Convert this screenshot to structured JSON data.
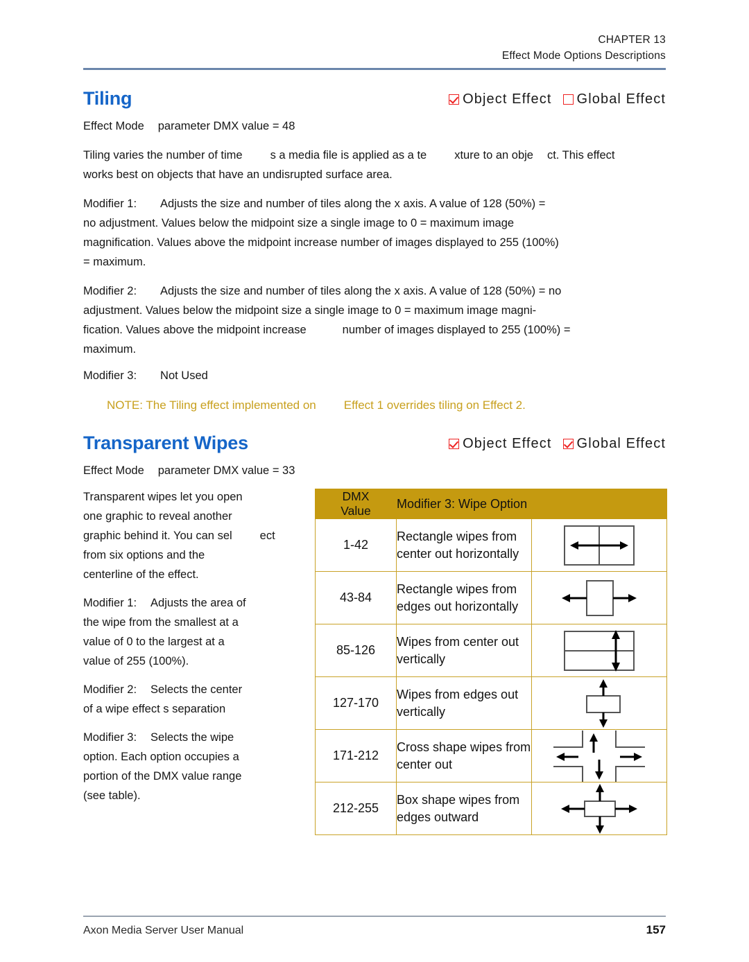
{
  "header": {
    "chapter": "CHAPTER 13",
    "section": "Effect Mode Options Descriptions"
  },
  "sections": [
    {
      "title": "Tiling",
      "flags": [
        {
          "label": "Object Effect",
          "checked": true
        },
        {
          "label": "Global Effect",
          "checked": false
        }
      ],
      "dmx_line_a": "Effect Mode",
      "dmx_line_b": "parameter DMX value = 48",
      "intro_a": "Tiling varies the number of time",
      "intro_b": "s a media file is applied as a te",
      "intro_c": "xture to an obje",
      "intro_d": "ct. This effect",
      "intro_e": "works best on objects that have an undisrupted surface area.",
      "mod1_label": "Modifier 1:",
      "mod1_a": "Adjusts the size and number of tiles along the x axis. A value of 128 (50%) =",
      "mod1_b": "no adjustment. Values below the midpoint size a single image to 0 = maximum image",
      "mod1_c": "magnification. Values above the midpoint increase number of images displayed to 255 (100%)",
      "mod1_d": "= maximum.",
      "mod2_label": "Modifier 2:",
      "mod2_a": "Adjusts the size and number of tiles along the x axis. A value of 128 (50%) = no",
      "mod2_b": "adjustment. Values below the midpoint size a single image to 0 = maximum image magni-",
      "mod2_c": "fication. Values above the midpoint increase",
      "mod2_d": "number of images displayed to 255 (100%) =",
      "mod2_e": "maximum.",
      "mod3_label": "Modifier 3:",
      "mod3_value": "Not Used",
      "note_a": "NOTE: The Tiling effect implemented on",
      "note_b": "Effect 1 overrides tiling on Effect 2."
    },
    {
      "title": "Transparent Wipes",
      "flags": [
        {
          "label": "Object Effect",
          "checked": true
        },
        {
          "label": "Global Effect",
          "checked": true
        }
      ],
      "dmx_line_a": "Effect Mode",
      "dmx_line_b": "parameter DMX value = 33",
      "left_p1_a": "Transparent wipes let you open",
      "left_p1_b": "one graphic to reveal another",
      "left_p1_c": "graphic behind it. You can sel",
      "left_p1_d": "ect",
      "left_p1_e": "from six options and the",
      "left_p1_f": "centerline of the effect.",
      "mod1_label": "Modifier 1:",
      "mod1_a": "Adjusts the area of",
      "mod1_b": "the wipe from the smallest at a",
      "mod1_c": "value of 0 to the largest at a",
      "mod1_d": "value of 255 (100%).",
      "mod2_label": "Modifier 2:",
      "mod2_a": "Selects the center",
      "mod2_b": "of a wipe effect s separation",
      "mod3_label": "Modifier 3:",
      "mod3_a": "Selects the wipe",
      "mod3_b": "option. Each option occupies a",
      "mod3_c": "portion of the DMX value range",
      "mod3_d": "(see table)."
    }
  ],
  "table": {
    "header": {
      "col_value_line1": "DMX",
      "col_value_line2": "Value",
      "col_option": "Modifier 3: Wipe Option"
    },
    "rows": [
      {
        "value": "1-42",
        "desc_line1": "Rectangle wipes from",
        "desc_line2": "center out horizontally",
        "figure": "rect-center-out-horizontal"
      },
      {
        "value": "43-84",
        "desc_line1": "Rectangle wipes from",
        "desc_line2": "edges out horizontally",
        "figure": "rect-edges-out-horizontal"
      },
      {
        "value": "85-126",
        "desc_line1": "Wipes from center out",
        "desc_line2": "vertically",
        "figure": "rect-center-out-vertical"
      },
      {
        "value": "127-170",
        "desc_line1": "Wipes from edges out",
        "desc_line2": "vertically",
        "figure": "rect-edges-out-vertical"
      },
      {
        "value": "171-212",
        "desc_line1": "Cross shape wipes from",
        "desc_line2": "center out",
        "figure": "cross-center-out"
      },
      {
        "value": "212-255",
        "desc_line1": "Box shape wipes from",
        "desc_line2": "edges outward",
        "figure": "box-edges-outward"
      }
    ]
  },
  "footer": {
    "manual": "Axon Media Server User Manual",
    "page": "157"
  },
  "colors": {
    "heading_blue": "#1565c8",
    "note_gold": "#c8a01e",
    "table_header_gold": "#c59a10",
    "table_border_gold": "#c9a227",
    "checkbox_red": "#ee2222",
    "header_rule_blue": "#6b86ab"
  }
}
